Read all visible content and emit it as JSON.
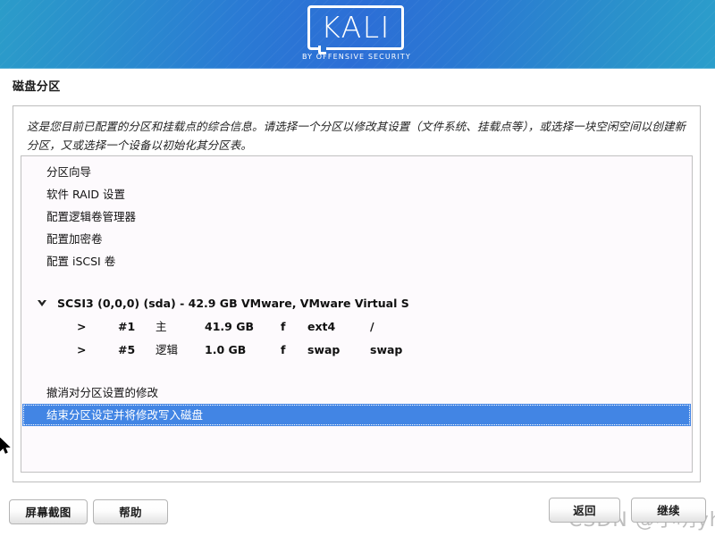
{
  "banner": {
    "logo_text": "KALI",
    "logo_subtitle": "BY OFFENSIVE SECURITY"
  },
  "page": {
    "title": "磁盘分区",
    "description": "这是您目前已配置的分区和挂载点的综合信息。请选择一个分区以修改其设置（文件系统、挂载点等），或选择一块空闲空间以创建新分区，又或选择一个设备以初始化其分区表。"
  },
  "menu_items": [
    {
      "label": "分区向导"
    },
    {
      "label": "软件 RAID 设置"
    },
    {
      "label": "配置逻辑卷管理器"
    },
    {
      "label": "配置加密卷"
    },
    {
      "label": "配置 iSCSI 卷"
    }
  ],
  "disk": {
    "label": "SCSI3 (0,0,0) (sda) - 42.9 GB VMware, VMware Virtual S",
    "expanded": true
  },
  "partitions": [
    {
      "marker": ">",
      "number": "#1",
      "type": "主",
      "size": "41.9 GB",
      "flag": "f",
      "filesystem": "ext4",
      "mountpoint": "/"
    },
    {
      "marker": ">",
      "number": "#5",
      "type": "逻辑",
      "size": "1.0 GB",
      "flag": "f",
      "filesystem": "swap",
      "mountpoint": "swap"
    }
  ],
  "actions": [
    {
      "label": "撤消对分区设置的修改",
      "selected": false
    },
    {
      "label": "结束分区设定并将修改写入磁盘",
      "selected": true
    }
  ],
  "buttons": {
    "screenshot": "屏幕截图",
    "help": "帮助",
    "back": "返回",
    "continue": "继续"
  },
  "watermark": {
    "text": "CSDN @小明yhu"
  },
  "colors": {
    "banner_left": "#2b9cc9",
    "banner_center": "#2c6ed6",
    "selection": "#4285e4",
    "list_background": "#fdfafd",
    "panel_border": "#bdbdbd"
  }
}
